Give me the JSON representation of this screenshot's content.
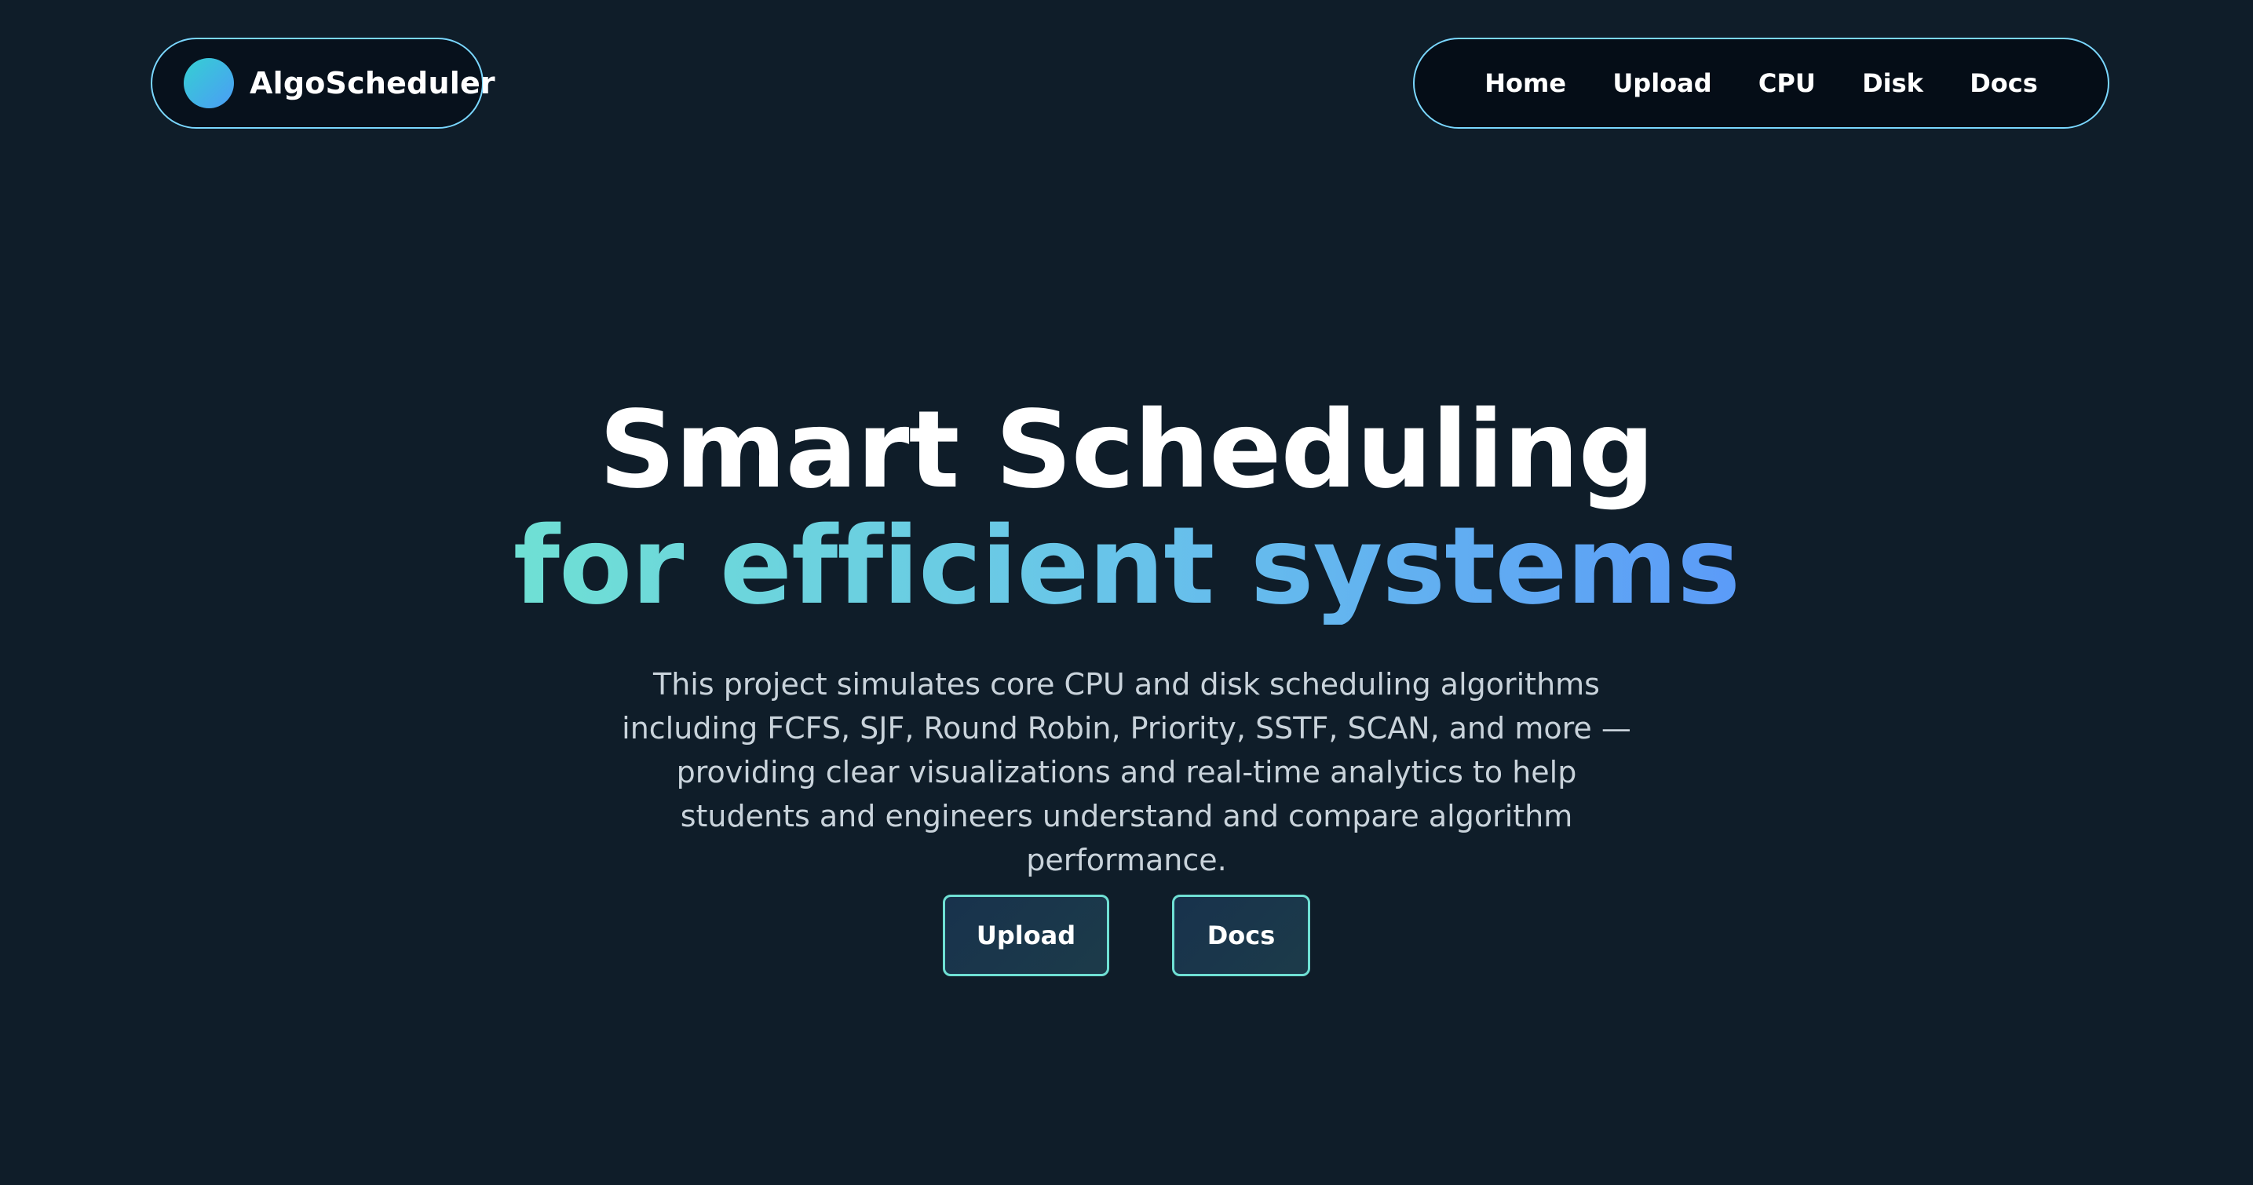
{
  "brand": {
    "name": "AlgoScheduler"
  },
  "nav": {
    "items": [
      {
        "label": "Home"
      },
      {
        "label": "Upload"
      },
      {
        "label": "CPU"
      },
      {
        "label": "Disk"
      },
      {
        "label": "Docs"
      }
    ]
  },
  "hero": {
    "title_line1": "Smart Scheduling",
    "title_line2": "for efficient systems",
    "description": "This project simulates core CPU and disk scheduling algorithms including FCFS, SJF, Round Robin, Priority, SSTF, SCAN, and more — providing clear visualizations and real-time analytics to help students and engineers understand and compare algorithm performance."
  },
  "actions": {
    "upload_label": "Upload",
    "docs_label": "Docs"
  },
  "colors": {
    "background": "#0f1d29",
    "border_accent": "#7ad7ff",
    "gradient_start": "#6fe0d4",
    "gradient_end": "#5b9bf8",
    "button_border": "#6fe0d4"
  }
}
